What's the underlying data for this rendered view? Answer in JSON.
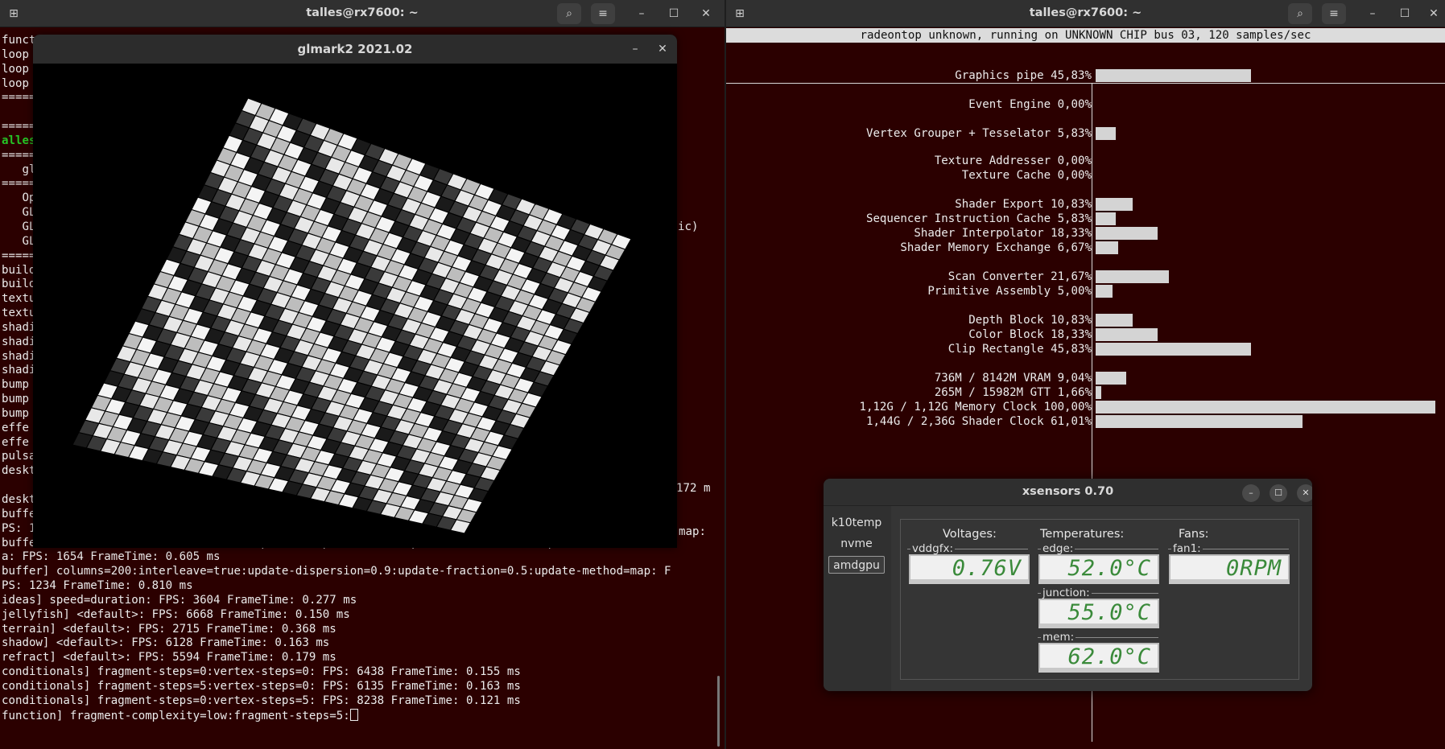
{
  "left_terminal": {
    "title": "talles@rx7600: ~",
    "new_tab_icon": "new-tab-icon",
    "search_icon": "search-icon",
    "menu_icon": "hamburger-menu-icon",
    "min": "–",
    "max": "☐",
    "close": "✕",
    "lines": [
      "funct",
      "loop",
      "loop",
      "loop",
      "=====",
      "",
      "=====",
      "alles",
      "=====",
      "   gl",
      "=====",
      "   Op",
      "   GL",
      "   GL",
      "   GL",
      "=====",
      "build",
      "build",
      "textu",
      "textu",
      "shadi",
      "shadi",
      "shadi",
      "shadi",
      "bump",
      "bump",
      "bump",
      "effe",
      "effe",
      "pulsa",
      "deskt",
      "",
      "deskt",
      "buffe",
      "PS: 1362 FrameTime: 0.768 ms",
      "buffer] columns=200:interleave=false:update-dispersion=0.9:update-fraction=0.5:update-method=subda",
      "a: FPS: 1654 FrameTime: 0.605 ms",
      "buffer] columns=200:interleave=true:update-dispersion=0.9:update-fraction=0.5:update-method=map: F",
      "PS: 1234 FrameTime: 0.810 ms",
      "ideas] speed=duration: FPS: 3604 FrameTime: 0.277 ms",
      "jellyfish] <default>: FPS: 6668 FrameTime: 0.150 ms",
      "terrain] <default>: FPS: 2715 FrameTime: 0.368 ms",
      "shadow] <default>: FPS: 6128 FrameTime: 0.163 ms",
      "refract] <default>: FPS: 5594 FrameTime: 0.179 ms",
      "conditionals] fragment-steps=0:vertex-steps=0: FPS: 6438 FrameTime: 0.155 ms",
      "conditionals] fragment-steps=5:vertex-steps=0: FPS: 6135 FrameTime: 0.163 ms",
      "conditionals] fragment-steps=0:vertex-steps=5: FPS: 8238 FrameTime: 0.121 ms",
      "function] fragment-complexity=low:fragment-steps=5:"
    ],
    "side_fragments": {
      "ic": "ic)",
      "m172": "172 m",
      "map": "map:"
    }
  },
  "glmark": {
    "title": "glmark2 2021.02",
    "min": "–",
    "close": "✕"
  },
  "right_terminal": {
    "title": "talles@rx7600: ~",
    "header": "radeontop unknown, running on UNKNOWN CHIP bus 03, 120 samples/sec",
    "rows": [
      {
        "label": "Graphics pipe",
        "value": "45,83%",
        "pct": 45.83
      },
      {
        "label": "Event Engine",
        "value": "0,00%",
        "pct": 0
      },
      {
        "label": "Vertex Grouper + Tesselator",
        "value": "5,83%",
        "pct": 5.83
      },
      {
        "label": "Texture Addresser",
        "value": "0,00%",
        "pct": 0
      },
      {
        "label": "Texture Cache",
        "value": "0,00%",
        "pct": 0
      },
      {
        "label": "Shader Export",
        "value": "10,83%",
        "pct": 10.83
      },
      {
        "label": "Sequencer Instruction Cache",
        "value": "5,83%",
        "pct": 5.83
      },
      {
        "label": "Shader Interpolator",
        "value": "18,33%",
        "pct": 18.33
      },
      {
        "label": "Shader Memory Exchange",
        "value": "6,67%",
        "pct": 6.67
      },
      {
        "label": "Scan Converter",
        "value": "21,67%",
        "pct": 21.67
      },
      {
        "label": "Primitive Assembly",
        "value": "5,00%",
        "pct": 5.0
      },
      {
        "label": "Depth Block",
        "value": "10,83%",
        "pct": 10.83
      },
      {
        "label": "Color Block",
        "value": "18,33%",
        "pct": 18.33
      },
      {
        "label": "Clip Rectangle",
        "value": "45,83%",
        "pct": 45.83
      },
      {
        "label": "736M / 8142M VRAM",
        "value": "9,04%",
        "pct": 9.04
      },
      {
        "label": "265M / 15982M GTT",
        "value": "1,66%",
        "pct": 1.66
      },
      {
        "label": "1,12G / 1,12G Memory Clock",
        "value": "100,00%",
        "pct": 100
      },
      {
        "label": "1,44G / 2,36G Shader Clock",
        "value": "61,01%",
        "pct": 61.01
      }
    ]
  },
  "xsensors": {
    "title": "xsensors 0.70",
    "tabs": [
      "k10temp",
      "nvme",
      "amdgpu"
    ],
    "selected_tab": "amdgpu",
    "voltages_header": "Voltages:",
    "temperatures_header": "Temperatures:",
    "fans_header": "Fans:",
    "vddgfx_label": "vddgfx:",
    "vddgfx_value": "0.76V",
    "edge_label": "edge:",
    "edge_value": "52.0°C",
    "junction_label": "junction:",
    "junction_value": "55.0°C",
    "mem_label": "mem:",
    "mem_value": "62.0°C",
    "fan1_label": "fan1:",
    "fan1_value": "0RPM",
    "min": "–",
    "max": "☐",
    "close": "✕"
  }
}
